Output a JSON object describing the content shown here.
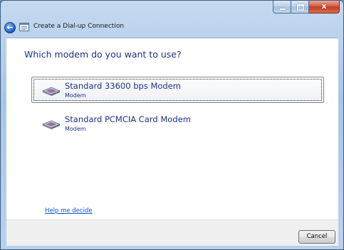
{
  "window": {
    "title": "Create a Dial-up Connection",
    "caption_close": "x"
  },
  "content": {
    "heading": "Which modem do you want to use?",
    "options": [
      {
        "title": "Standard 33600 bps Modem",
        "subtitle": "Modem",
        "selected": true
      },
      {
        "title": "Standard PCMCIA Card Modem",
        "subtitle": "Modem",
        "selected": false
      }
    ],
    "help_link": "Help me decide"
  },
  "footer": {
    "cancel_label": "Cancel"
  },
  "icons": {
    "back": "back-arrow-icon",
    "wizard": "wizard-window-icon",
    "modem": "modem-icon"
  },
  "colors": {
    "heading_text": "#1e3287",
    "link": "#0b56c9",
    "frame": "#b9d1ec"
  }
}
